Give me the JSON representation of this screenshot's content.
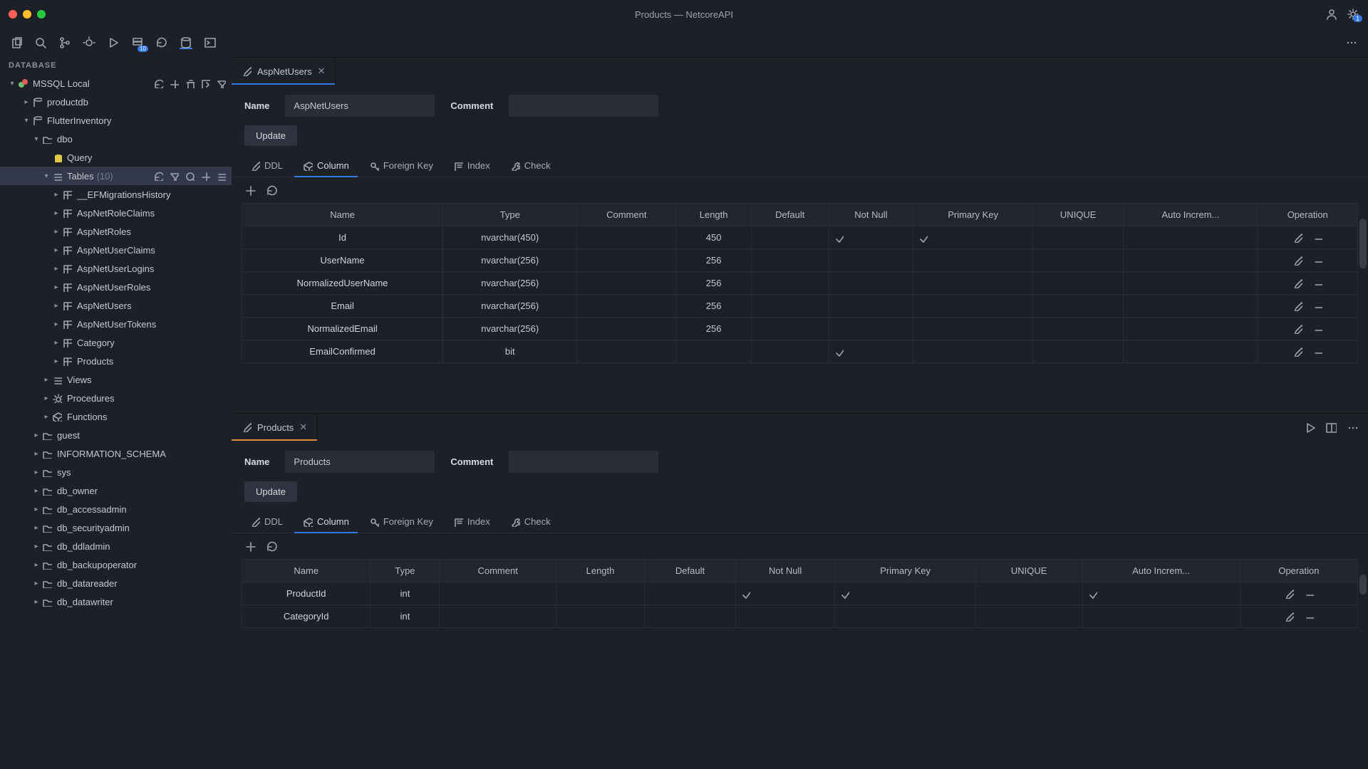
{
  "title": "Products — NetcoreAPI",
  "sidebar": {
    "header": "DATABASE",
    "connection": "MSSQL Local",
    "dbs": [
      "productdb",
      "FlutterInventory"
    ],
    "schema": "dbo",
    "groups": {
      "query": "Query",
      "tables": "Tables",
      "tables_count": "(10)",
      "views": "Views",
      "procedures": "Procedures",
      "functions": "Functions"
    },
    "tables": [
      "__EFMigrationsHistory",
      "AspNetRoleClaims",
      "AspNetRoles",
      "AspNetUserClaims",
      "AspNetUserLogins",
      "AspNetUserRoles",
      "AspNetUsers",
      "AspNetUserTokens",
      "Category",
      "Products"
    ],
    "schemas": [
      "guest",
      "INFORMATION_SCHEMA",
      "sys",
      "db_owner",
      "db_accessadmin",
      "db_securityadmin",
      "db_ddladmin",
      "db_backupoperator",
      "db_datareader",
      "db_datawriter"
    ]
  },
  "pane1": {
    "tab": "AspNetUsers",
    "name_label": "Name",
    "name_value": "AspNetUsers",
    "comment_label": "Comment",
    "comment_value": "",
    "update": "Update",
    "subtabs": [
      "DDL",
      "Column",
      "Foreign Key",
      "Index",
      "Check"
    ],
    "cols": [
      "Name",
      "Type",
      "Comment",
      "Length",
      "Default",
      "Not Null",
      "Primary Key",
      "UNIQUE",
      "Auto Increm...",
      "Operation"
    ],
    "rows": [
      {
        "name": "Id",
        "type": "nvarchar(450)",
        "len": "450",
        "nn": true,
        "pk": true
      },
      {
        "name": "UserName",
        "type": "nvarchar(256)",
        "len": "256"
      },
      {
        "name": "NormalizedUserName",
        "type": "nvarchar(256)",
        "len": "256"
      },
      {
        "name": "Email",
        "type": "nvarchar(256)",
        "len": "256"
      },
      {
        "name": "NormalizedEmail",
        "type": "nvarchar(256)",
        "len": "256"
      },
      {
        "name": "EmailConfirmed",
        "type": "bit",
        "nn": true
      }
    ]
  },
  "pane2": {
    "tab": "Products",
    "name_label": "Name",
    "name_value": "Products",
    "comment_label": "Comment",
    "comment_value": "",
    "update": "Update",
    "subtabs": [
      "DDL",
      "Column",
      "Foreign Key",
      "Index",
      "Check"
    ],
    "cols": [
      "Name",
      "Type",
      "Comment",
      "Length",
      "Default",
      "Not Null",
      "Primary Key",
      "UNIQUE",
      "Auto Increm...",
      "Operation"
    ],
    "rows": [
      {
        "name": "ProductId",
        "type": "int",
        "nn": true,
        "pk": true,
        "ai": true
      },
      {
        "name": "CategoryId",
        "type": "int"
      }
    ]
  }
}
